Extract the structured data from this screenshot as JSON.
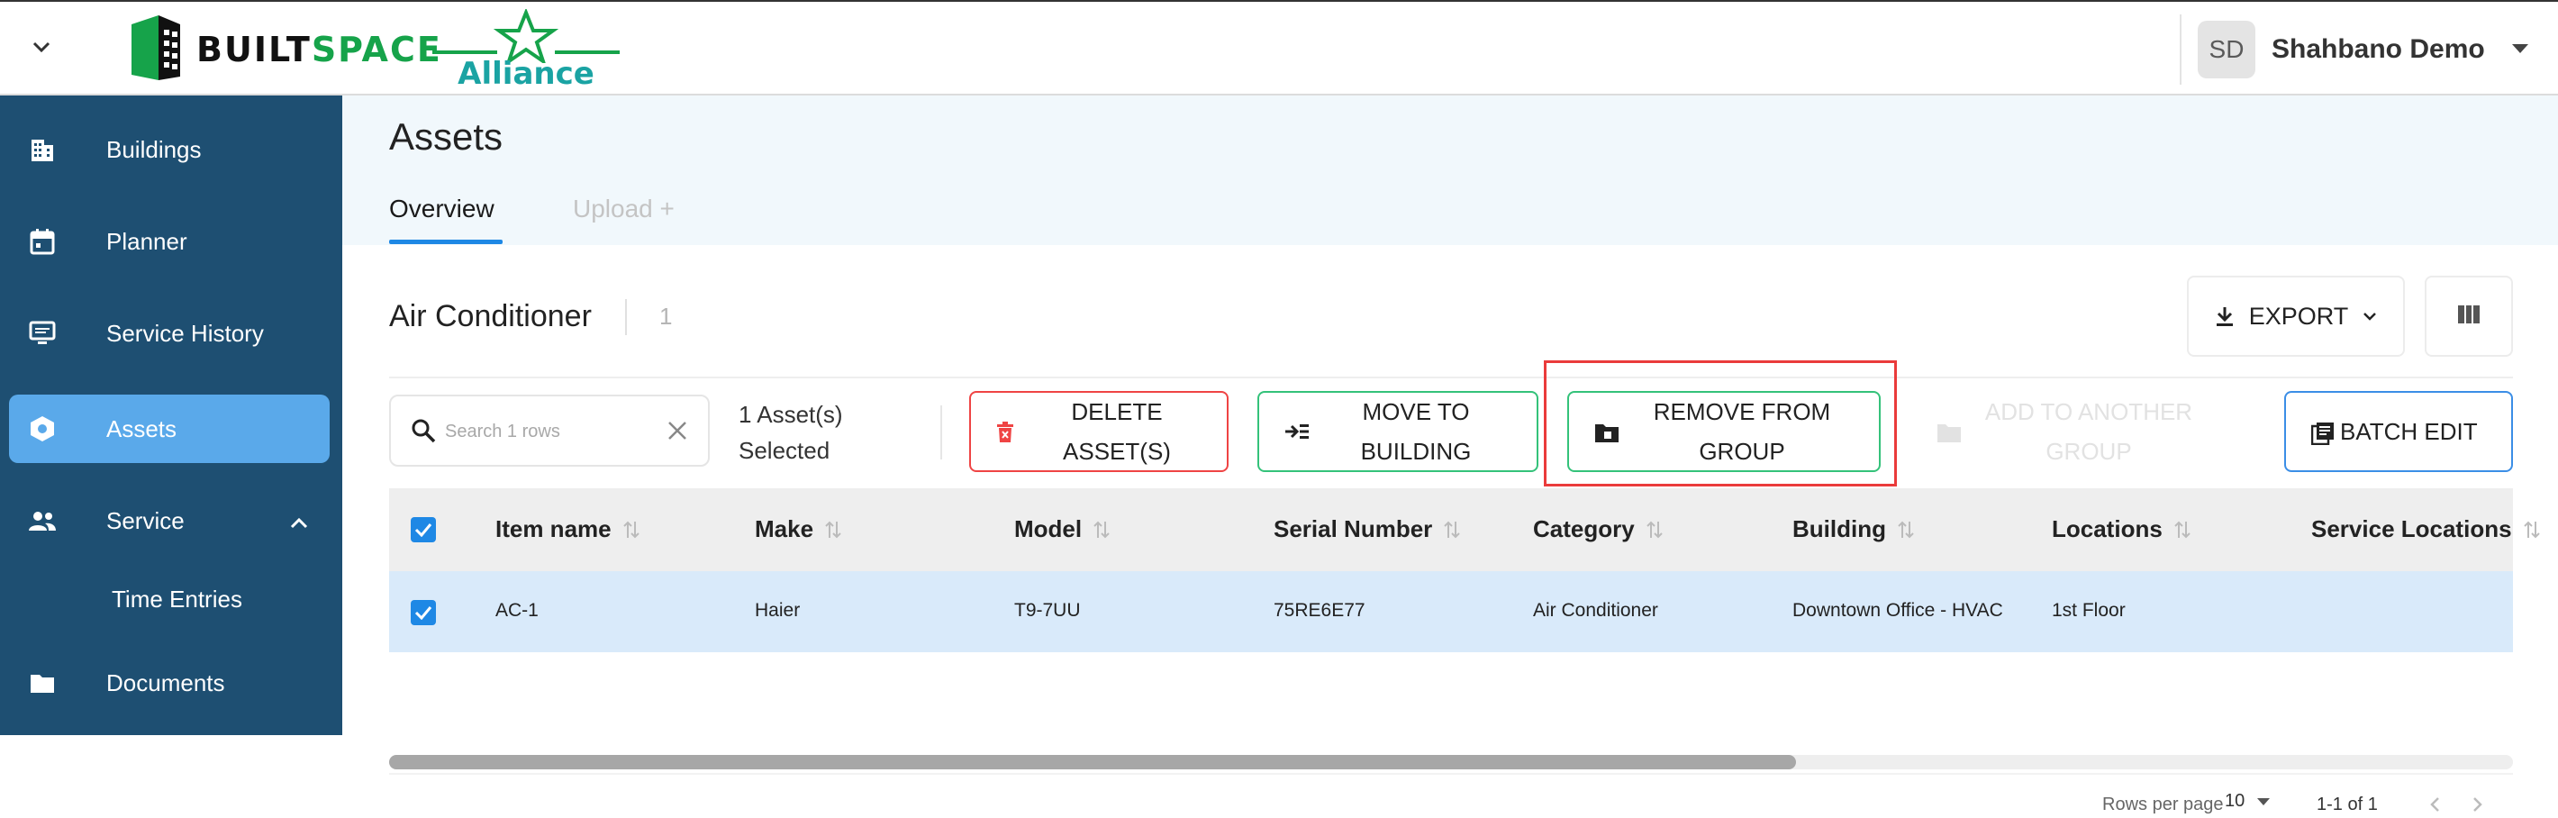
{
  "app": {
    "brand_left": "BUILT",
    "brand_right": "SPACE",
    "partner": "Alliance",
    "brand_color": "#16a34a",
    "partner_color": "#1aa3a3"
  },
  "user": {
    "initials": "SD",
    "name": "Shahbano Demo"
  },
  "sidebar": {
    "bg": "#1e4f72",
    "active_bg": "#5aa9ea",
    "items": [
      {
        "label": "Buildings",
        "icon": "building-icon"
      },
      {
        "label": "Planner",
        "icon": "calendar-icon"
      },
      {
        "label": "Service History",
        "icon": "monitor-icon"
      },
      {
        "label": "Assets",
        "icon": "hexagon-icon",
        "active": true
      },
      {
        "label": "Service",
        "icon": "people-icon",
        "expanded": true
      },
      {
        "label": "Time Entries",
        "sub": true
      },
      {
        "label": "Documents",
        "icon": "folder-icon"
      }
    ]
  },
  "page": {
    "title": "Assets",
    "tabs": [
      {
        "label": "Overview",
        "active": true
      },
      {
        "label": "Upload +",
        "disabled": true
      }
    ]
  },
  "group": {
    "title": "Air Conditioner",
    "count": "1",
    "export_label": "EXPORT"
  },
  "toolbar": {
    "search_placeholder": "Search 1 rows",
    "selection_line1": "1 Asset(s)",
    "selection_line2": "Selected",
    "delete_line1": "DELETE",
    "delete_line2": "ASSET(S)",
    "move_line1": "MOVE TO",
    "move_line2": "BUILDING",
    "remove_line1": "REMOVE FROM",
    "remove_line2": "GROUP",
    "add_line1": "ADD TO ANOTHER",
    "add_line2": "GROUP",
    "batch_label": "BATCH EDIT"
  },
  "table": {
    "columns": [
      "Item name",
      "Make",
      "Model",
      "Serial Number",
      "Category",
      "Building",
      "Locations",
      "Service Locations"
    ],
    "rows": [
      {
        "item_name": "AC-1",
        "make": "Haier",
        "model": "T9-7UU",
        "serial": "75RE6E77",
        "category": "Air Conditioner",
        "building": "Downtown Office - HVAC",
        "locations": "1st Floor",
        "service_locations": ""
      }
    ]
  },
  "pagination": {
    "rows_per_page_label": "Rows per page",
    "rows_per_page": "10",
    "range": "1-1 of 1"
  }
}
